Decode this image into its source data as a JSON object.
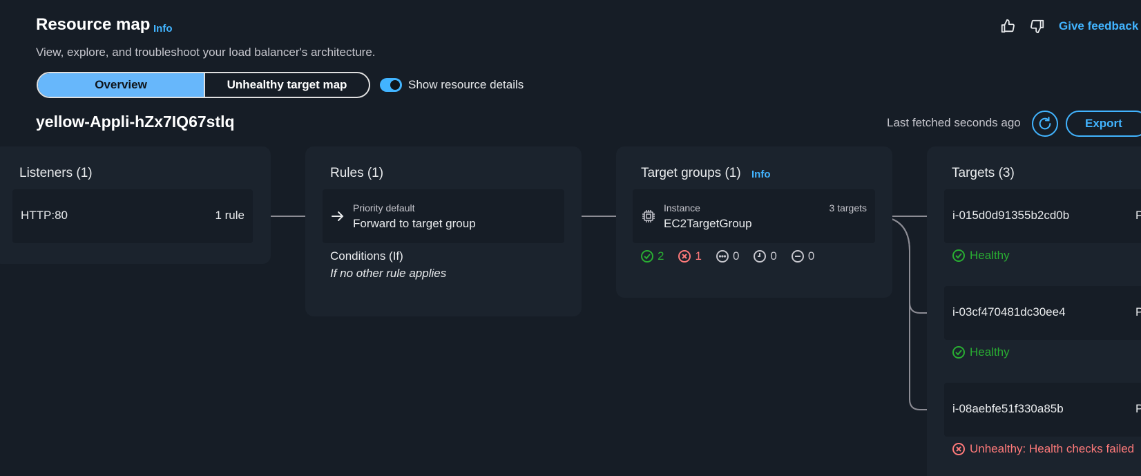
{
  "header": {
    "title": "Resource map",
    "info": "Info",
    "subtitle": "View, explore, and troubleshoot your load balancer's architecture.",
    "like_icon": "thumbs-up-icon",
    "dislike_icon": "thumbs-down-icon",
    "feedback": "Give feedback"
  },
  "tabs": {
    "overview": "Overview",
    "unhealthy": "Unhealthy target map"
  },
  "toggle": {
    "label": "Show resource details",
    "on": true
  },
  "load_balancer": {
    "name": "yellow-Appli-hZx7IQ67stlq"
  },
  "fetch": {
    "text": "Last fetched seconds ago",
    "refresh_icon": "refresh-icon",
    "export": "Export"
  },
  "listeners": {
    "title": "Listeners (1)",
    "items": [
      {
        "protocol": "HTTP:80",
        "rules": "1 rule"
      }
    ]
  },
  "rules": {
    "title": "Rules (1)",
    "items": [
      {
        "priority": "Priority default",
        "action": "Forward to target group"
      }
    ],
    "conditions_label": "Conditions (If)",
    "conditions_value": "If no other rule applies"
  },
  "target_groups": {
    "title": "Target groups (1)",
    "info": "Info",
    "items": [
      {
        "type": "Instance",
        "name": "EC2TargetGroup",
        "targets": "3 targets"
      }
    ],
    "counts": {
      "healthy": "2",
      "unhealthy": "1",
      "unused": "0",
      "draining": "0",
      "unavailable": "0"
    }
  },
  "targets": {
    "title": "Targets (3)",
    "items": [
      {
        "id": "i-015d0d91355b2cd0b",
        "trail": "P",
        "status": "Healthy"
      },
      {
        "id": "i-03cf470481dc30ee4",
        "trail": "P",
        "status": "Healthy"
      },
      {
        "id": "i-08aebfe51f330a85b",
        "trail": "P",
        "status": "Unhealthy: Health checks failed"
      }
    ]
  },
  "colors": {
    "accent": "#42b4ff",
    "healthy": "#29ad32",
    "unhealthy": "#ff7a7a",
    "background": "#161d26",
    "panel": "#1b232d"
  }
}
